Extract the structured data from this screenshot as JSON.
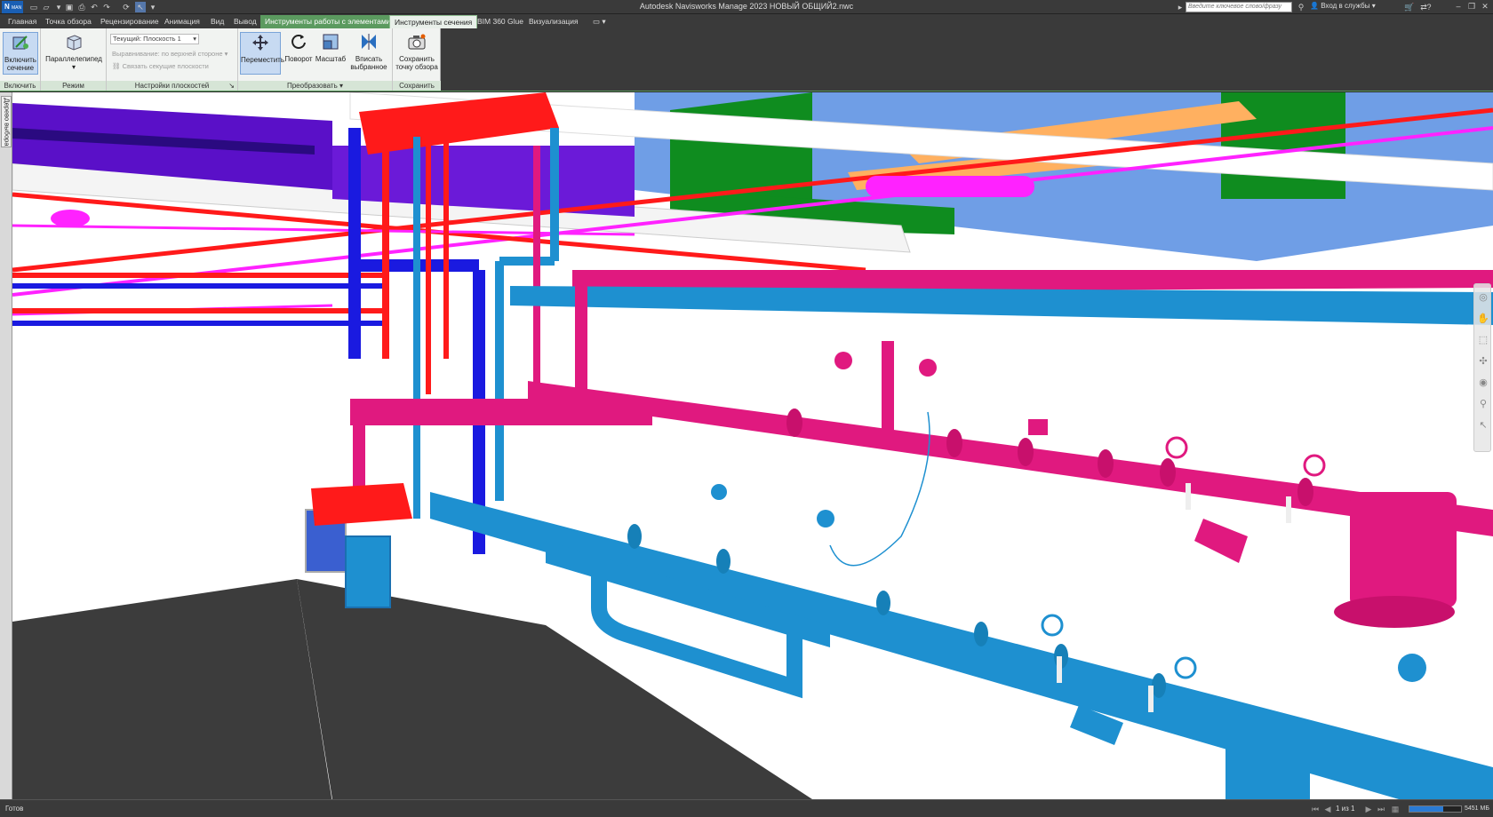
{
  "titlebar": {
    "logo": "N",
    "logo_sub": "MAN",
    "title": "Autodesk Navisworks Manage 2023   НОВЫЙ ОБЩИЙ2.nwc",
    "search_placeholder": "Введите ключевое слово/фразу",
    "signin": "Вход в службы"
  },
  "tabs": [
    {
      "label": "Главная"
    },
    {
      "label": "Точка обзора"
    },
    {
      "label": "Рецензирование"
    },
    {
      "label": "Анимация"
    },
    {
      "label": "Вид"
    },
    {
      "label": "Вывод"
    },
    {
      "label": "Инструменты работы с элементами"
    },
    {
      "label": "Инструменты сечения"
    },
    {
      "label": "BIM 360 Glue"
    },
    {
      "label": "Визуализация"
    }
  ],
  "ribbon": {
    "enable": {
      "button": "Включить сечение",
      "group": "Включить"
    },
    "mode": {
      "button": "Параллелепипед",
      "group": "Режим"
    },
    "plane_settings": {
      "current": "Текущий: Плоскость 1",
      "align": "Выравнивание: по верхней стороне",
      "link": "Связать секущие плоскости",
      "group": "Настройки плоскостей"
    },
    "transform": {
      "move": "Переместить",
      "rotate": "Поворот",
      "scale": "Масштаб",
      "fit": "Вписать выбранное",
      "group": "Преобразовать"
    },
    "save": {
      "button": "Сохранить точку обзора",
      "group": "Сохранить"
    }
  },
  "left_dock": {
    "selection_tree": "Дерево выбора"
  },
  "status": {
    "text": "Готов",
    "page": "1 из 1",
    "memory": "5451 МБ",
    "memory_fraction": 0.65
  },
  "colors": {
    "accent_green": "#5b9a5f",
    "pipe_magenta": "#e0197f",
    "pipe_cyan": "#1e90d0",
    "pipe_red": "#ff1a1a",
    "pipe_blue": "#1a1ae0",
    "floor": "#3c3c3c"
  }
}
